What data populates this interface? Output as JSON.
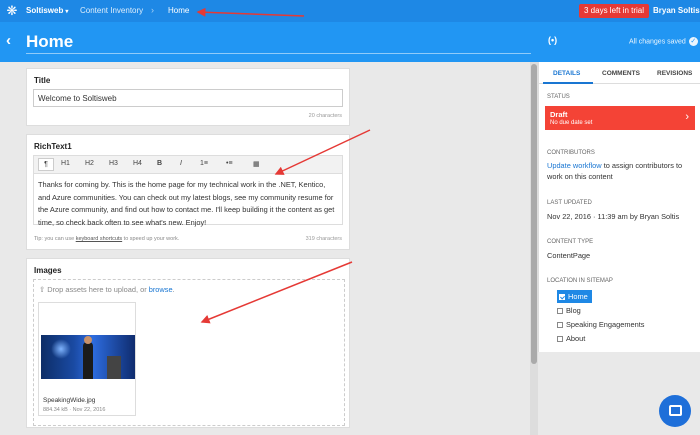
{
  "topbar": {
    "project": "Soltisweb",
    "crumb1": "Content Inventory",
    "separator": "›",
    "crumb2": "Home",
    "trial_badge": "3 days left in trial",
    "user": "Bryan Soltis"
  },
  "header": {
    "back_icon": "‹",
    "title": "Home",
    "wifi_icon": "(•)",
    "saved_status": "All changes saved",
    "check_icon": "✓"
  },
  "title_field": {
    "label": "Title",
    "value": "Welcome to Soltisweb",
    "count": "20 characters"
  },
  "richtext": {
    "label": "RichText1",
    "toolbar": [
      "¶",
      "H1",
      "H2",
      "H3",
      "H4",
      "B",
      "I",
      "1≡",
      "•≡",
      "▦"
    ],
    "content": "Thanks for coming by. This is the home page for my technical work in the .NET, Kentico, and Azure communities. You can check out my latest blogs, see my community resume for the Azure community, and find out how to contact me. I'll keep building it the content as get time, so check back often to see what's new. Enjoy!",
    "tips_before": "Tip: you can use ",
    "tips_link": "keyboard shortcuts",
    "tips_after": " to speed up your work.",
    "count": "319 characters"
  },
  "images": {
    "label": "Images",
    "drop_icon": "⇧",
    "drop_text": " Drop assets here to upload, or ",
    "drop_link": "browse",
    "drop_end": ".",
    "asset_name": "SpeakingWide.jpg",
    "asset_meta": "884.34 kB · Nov 22, 2016"
  },
  "sidebar": {
    "tabs": [
      "DETAILS",
      "COMMENTS",
      "REVISIONS"
    ],
    "status_label": "STATUS",
    "status_value": "Draft",
    "status_sub": "No due date set",
    "status_arrow": "›",
    "contributors_label": "CONTRIBUTORS",
    "contributors_link": "Update workflow",
    "contributors_text": " to assign contributors to work on this content",
    "updated_label": "LAST UPDATED",
    "updated_value": "Nov 22, 2016 · 11:39 am by Bryan Soltis",
    "type_label": "CONTENT TYPE",
    "type_value": "ContentPage",
    "sitemap_label": "LOCATION IN SITEMAP",
    "sitemap": [
      "Home",
      "Blog",
      "Speaking Engagements",
      "About"
    ]
  },
  "colors": {
    "topbar": "#1e88e5",
    "header": "#2196f3",
    "status_red": "#f44336",
    "trial_red": "#e53935",
    "annotation_red": "#e53935"
  }
}
